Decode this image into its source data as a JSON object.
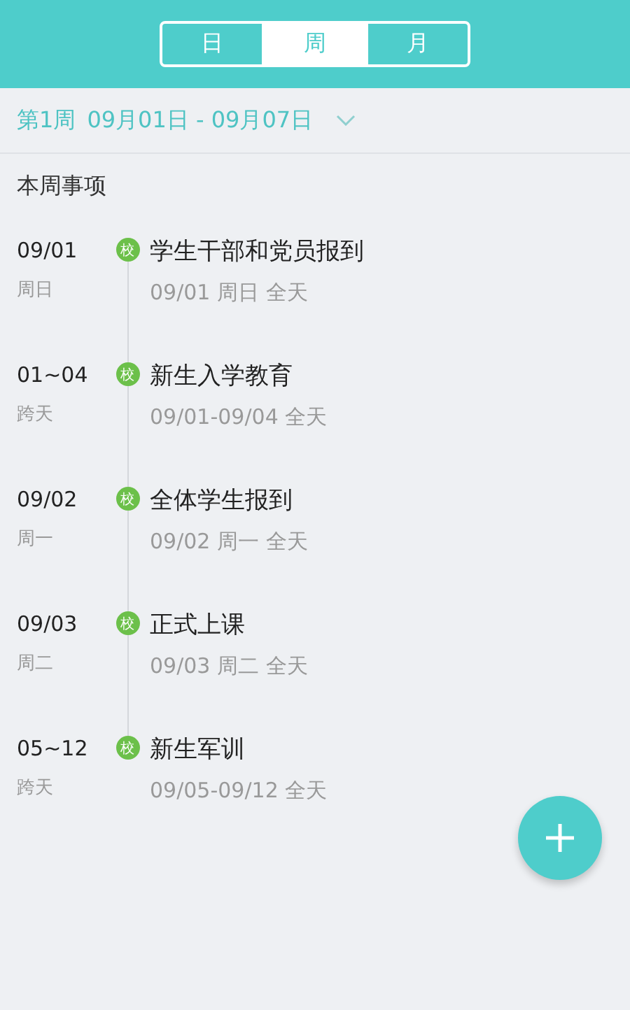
{
  "view_tabs": [
    {
      "label": "日",
      "selected": false
    },
    {
      "label": "周",
      "selected": true
    },
    {
      "label": "月",
      "selected": false
    }
  ],
  "week_bar": {
    "week": "第1周",
    "range": "09月01日 - 09月07日"
  },
  "section_title": "本周事项",
  "events": [
    {
      "date": "09/01",
      "weekday": "周日",
      "badge": "校",
      "title": "学生干部和党员报到",
      "time": "09/01 周日 全天"
    },
    {
      "date": "01~04",
      "weekday": "跨天",
      "badge": "校",
      "title": "新生入学教育",
      "time": "09/01-09/04 全天"
    },
    {
      "date": "09/02",
      "weekday": "周一",
      "badge": "校",
      "title": "全体学生报到",
      "time": "09/02 周一 全天"
    },
    {
      "date": "09/03",
      "weekday": "周二",
      "badge": "校",
      "title": "正式上课",
      "time": "09/03 周二 全天"
    },
    {
      "date": "05~12",
      "weekday": "跨天",
      "badge": "校",
      "title": "新生军训",
      "time": "09/05-09/12 全天"
    }
  ]
}
